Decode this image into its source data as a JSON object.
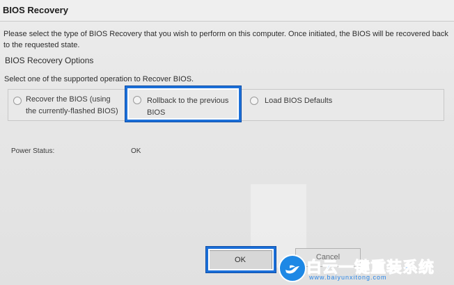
{
  "window": {
    "title": "BIOS Recovery"
  },
  "description": "Please select the type of BIOS Recovery that you wish to perform on this computer. Once initiated, the BIOS will be recovered back to the requested state.",
  "options_section": {
    "heading": "BIOS Recovery Options",
    "instruction": "Select one of the supported operation to Recover BIOS.",
    "options": [
      {
        "label_line1": "Recover the BIOS (using",
        "label_line2": "the currently-flashed BIOS)",
        "selected": false
      },
      {
        "label_line1": "Rollback to the previous",
        "label_line2": "BIOS",
        "selected": false,
        "highlighted": true
      },
      {
        "label_line1": "Load BIOS Defaults",
        "label_line2": "",
        "selected": false
      }
    ]
  },
  "power_status": {
    "label": "Power Status:",
    "value": "OK"
  },
  "buttons": {
    "ok": "OK",
    "cancel": "Cancel"
  },
  "watermark": {
    "text": "白云一键重装系统",
    "url": "www.baiyunxitong.com",
    "icon": "bird-icon"
  },
  "colors": {
    "highlight": "#1b6fd8",
    "background": "#e6e6e6",
    "watermark": "#2a86e8"
  }
}
